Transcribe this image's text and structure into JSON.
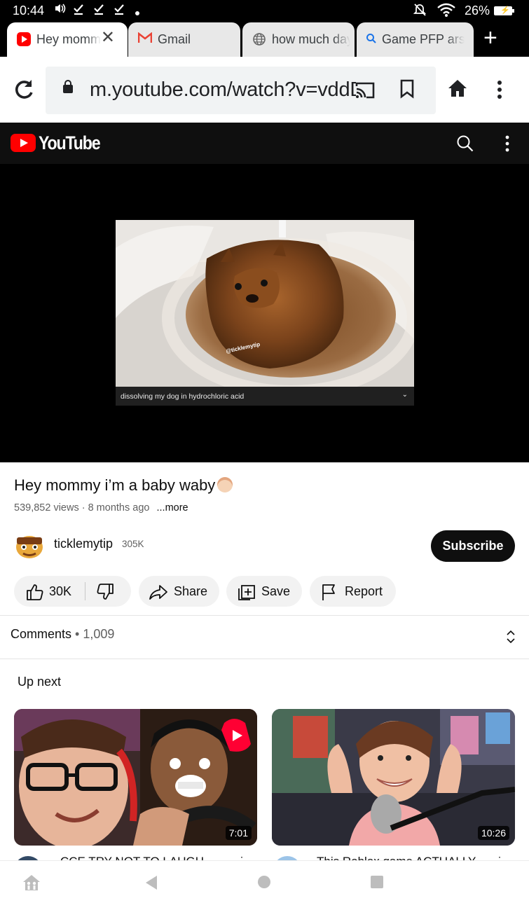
{
  "status_bar": {
    "time": "10:44",
    "battery": "26%"
  },
  "tabs": [
    {
      "title": "Hey momm",
      "icon": "youtube-favicon",
      "active": true
    },
    {
      "title": "Gmail",
      "icon": "gmail-favicon",
      "active": false
    },
    {
      "title": "how much day",
      "icon": "globe-icon",
      "active": false
    },
    {
      "title": "Game PFP ars",
      "icon": "search-icon",
      "active": false
    }
  ],
  "omnibox": {
    "url": "m.youtube.com/watch?v=vddD"
  },
  "youtube": {
    "logo_text": "YouTube"
  },
  "player": {
    "watermark": "@ticklemytip",
    "caption": "dissolving my dog in hydrochloric acid"
  },
  "video": {
    "title": "Hey mommy i’m a baby waby",
    "views": "539,852 views",
    "age": "8 months ago",
    "more": "...more",
    "channel_name": "ticklemytip",
    "subscribers": "305K",
    "subscribe_label": "Subscribe"
  },
  "actions": {
    "likes": "30K",
    "share": "Share",
    "save": "Save",
    "report": "Report"
  },
  "comments": {
    "label": "Comments",
    "count": "1,009"
  },
  "up_next": {
    "heading": "Up next",
    "videos": [
      {
        "duration": "7:01",
        "title": "CCE TRY NOT TO LAUGH"
      },
      {
        "duration": "10:26",
        "title": "This Roblox game ACTUALLY"
      }
    ]
  },
  "colors": {
    "youtube_red": "#ff0000",
    "header_dark": "#0f0f0f",
    "pill_bg": "#f2f2f2"
  }
}
